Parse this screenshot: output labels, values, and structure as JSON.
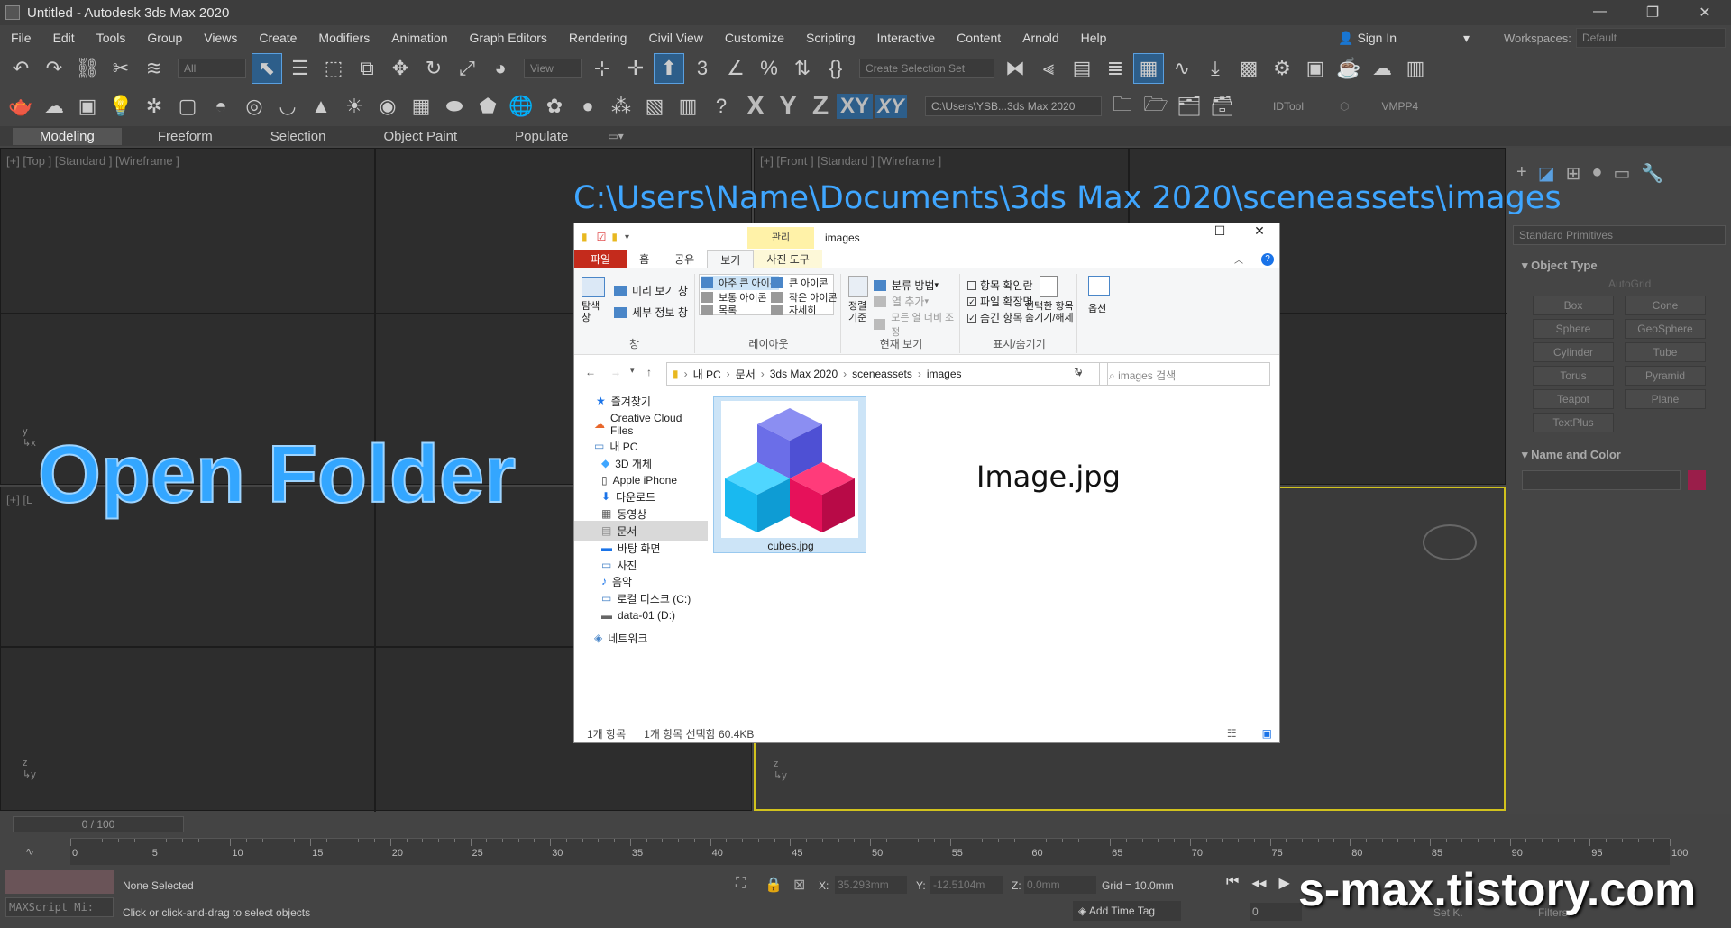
{
  "app": {
    "title": "Untitled - Autodesk 3ds Max 2020"
  },
  "menu": [
    "File",
    "Edit",
    "Tools",
    "Group",
    "Views",
    "Create",
    "Modifiers",
    "Animation",
    "Graph Editors",
    "Rendering",
    "Civil View",
    "Customize",
    "Scripting",
    "Interactive",
    "Content",
    "Arnold",
    "Help"
  ],
  "signin": "Sign In",
  "workspaces": {
    "label": "Workspaces:",
    "value": "Default"
  },
  "toolbar": {
    "filter": "All",
    "view": "View",
    "selection_set": "Create Selection Set",
    "axis": [
      "X",
      "Y",
      "Z",
      "XY",
      "XY"
    ],
    "path": "C:\\Users\\YSB...3ds Max 2020",
    "idtool": "IDTool",
    "vmpp4": "VMPP4"
  },
  "ribbon_tabs": [
    "Modeling",
    "Freeform",
    "Selection",
    "Object Paint",
    "Populate"
  ],
  "viewports": {
    "top": "[+] [Top ] [Standard ] [Wireframe ]",
    "front": "[+] [Front ] [Standard ] [Wireframe ]",
    "left": "[+] [L"
  },
  "command_panel": {
    "category": "Standard Primitives",
    "object_type": "Object Type",
    "autogrid": "AutoGrid",
    "buttons": [
      "Box",
      "Cone",
      "Sphere",
      "GeoSphere",
      "Cylinder",
      "Tube",
      "Torus",
      "Pyramid",
      "Teapot",
      "Plane",
      "TextPlus"
    ],
    "name_color": "Name and Color"
  },
  "timeline": {
    "frame": "0 / 100",
    "ticks": [
      "0",
      "5",
      "10",
      "15",
      "20",
      "25",
      "30",
      "35",
      "40",
      "45",
      "50",
      "55",
      "60",
      "65",
      "70",
      "75",
      "80",
      "85",
      "90",
      "95",
      "100"
    ]
  },
  "status": {
    "maxscript": "MAXScript Mi:",
    "selected": "None Selected",
    "hint": "Click or click-and-drag to select objects",
    "x_label": "X:",
    "x": "35.293mm",
    "y_label": "Y:",
    "y": "-12.5104m",
    "z_label": "Z:",
    "z": "0.0mm",
    "grid": "Grid = 10.0mm",
    "add_time_tag": "Add Time Tag",
    "set_key": "Set K.",
    "filters": "Filters...",
    "frame_field": "0"
  },
  "overlay": {
    "path": "C:\\Users\\Name\\Documents\\3ds Max 2020\\sceneassets\\images",
    "open_folder": "Open Folder",
    "site": "s-max.tistory.com",
    "image_label": "Image.jpg"
  },
  "explorer": {
    "manage_tab": "관리",
    "title": "images",
    "tabs": [
      "파일",
      "홈",
      "공유",
      "보기",
      "사진 도구"
    ],
    "pane": {
      "nav": "탐색\n창",
      "preview": "미리 보기 창",
      "details": "세부 정보 창",
      "label": "창"
    },
    "layout": {
      "items": [
        "아주 큰 아이콘",
        "큰 아이콘",
        "보통 아이콘",
        "작은 아이콘",
        "목록",
        "자세히"
      ],
      "label": "레이아웃"
    },
    "current": {
      "sort": "정렬\n기준",
      "group": "분류 방법",
      "add_col": "열 추가",
      "fit": "모든 열 너비 조정",
      "label": "현재 보기"
    },
    "show": {
      "checkboxes": "항목 확인란",
      "extensions": "파일 확장명",
      "hidden": "숨긴 항목",
      "hide_sel": "선택한 항목\n숨기기/해제",
      "label": "표시/숨기기"
    },
    "options": "옵션",
    "breadcrumb": [
      "내 PC",
      "문서",
      "3ds Max 2020",
      "sceneassets",
      "images"
    ],
    "search_placeholder": "images 검색",
    "nav": [
      "즐겨찾기",
      "Creative Cloud Files",
      "내 PC",
      "3D 개체",
      "Apple iPhone",
      "다운로드",
      "동영상",
      "문서",
      "바탕 화면",
      "사진",
      "음악",
      "로컬 디스크 (C:)",
      "data-01 (D:)",
      "네트워크"
    ],
    "file": "cubes.jpg",
    "status_count": "1개 항목",
    "status_sel": "1개 항목 선택함 60.4KB"
  },
  "colors": {
    "accent": "#3fa6ff",
    "cube_blue": "#5b5ee6",
    "cube_cyan": "#19b9f0",
    "cube_pink": "#e6115a",
    "name_swatch": "#9a1e4a"
  }
}
